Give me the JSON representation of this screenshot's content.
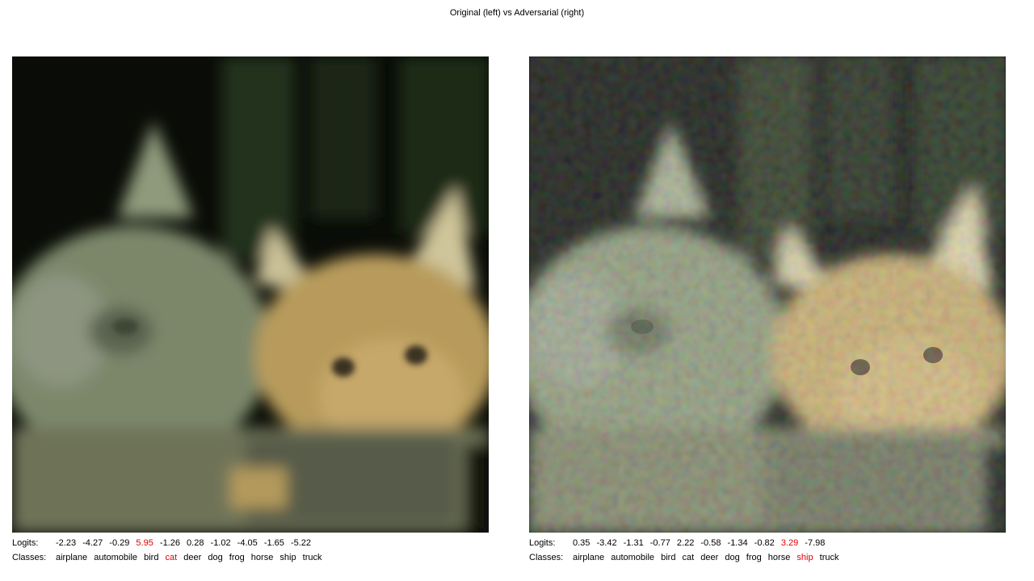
{
  "title": "Original (left) vs Adversarial (right)",
  "accent_color": "#e00000",
  "panels": [
    {
      "id": "original",
      "image_description_icon": "two-kittens-image",
      "logits_label": "Logits:",
      "classes_label": "Classes:",
      "logits": [
        "-2.23",
        "-4.27",
        "-0.29",
        "5.95",
        "-1.26",
        "0.28",
        "-1.02",
        "-4.05",
        "-1.65",
        "-5.22"
      ],
      "classes": [
        "airplane",
        "automobile",
        "bird",
        "cat",
        "deer",
        "dog",
        "frog",
        "horse",
        "ship",
        "truck"
      ],
      "highlight_index": 3
    },
    {
      "id": "adversarial",
      "image_description_icon": "two-kittens-noisy-image",
      "logits_label": "Logits:",
      "classes_label": "Classes:",
      "logits": [
        "0.35",
        "-3.42",
        "-1.31",
        "-0.77",
        "2.22",
        "-0.58",
        "-1.34",
        "-0.82",
        "3.29",
        "-7.98"
      ],
      "classes": [
        "airplane",
        "automobile",
        "bird",
        "cat",
        "deer",
        "dog",
        "frog",
        "horse",
        "ship",
        "truck"
      ],
      "highlight_index": 8
    }
  ]
}
